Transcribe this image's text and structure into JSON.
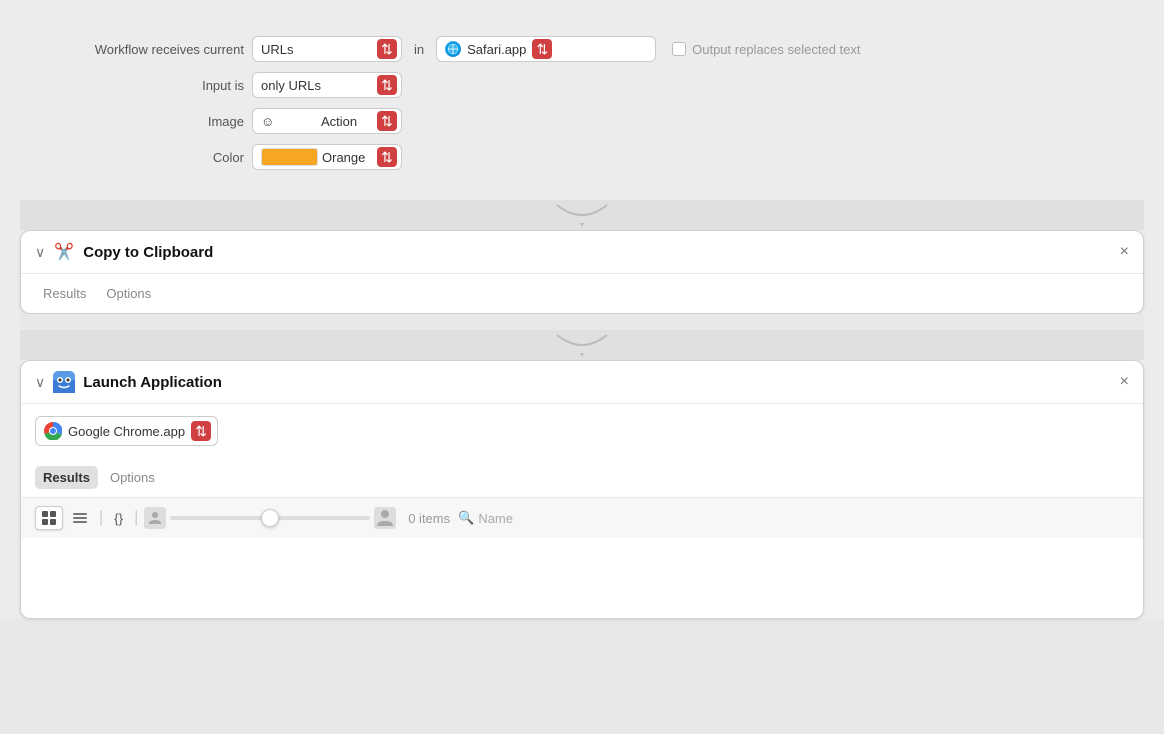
{
  "workflow": {
    "receives_label": "Workflow receives current",
    "input_type": "URLs",
    "in_label": "in",
    "app_name": "Safari.app",
    "input_is_label": "Input is",
    "input_is_value": "only URLs",
    "image_label": "Image",
    "image_value": "Action",
    "image_icon": "☺",
    "color_label": "Color",
    "color_value": "Orange",
    "output_label": "Output replaces selected text"
  },
  "copy_clipboard": {
    "title": "Copy to Clipboard",
    "icon": "✂",
    "tabs": [
      {
        "id": "results",
        "label": "Results",
        "active": false
      },
      {
        "id": "options",
        "label": "Options",
        "active": false
      }
    ],
    "close_label": "×"
  },
  "launch_application": {
    "title": "Launch Application",
    "icon": "🔵",
    "app_name": "Google Chrome.app",
    "close_label": "×",
    "tabs": [
      {
        "id": "results",
        "label": "Results",
        "active": true
      },
      {
        "id": "options",
        "label": "Options",
        "active": false
      }
    ],
    "items_count": "0 items",
    "search_label": "Name"
  },
  "toolbar": {
    "grid_icon": "⊞",
    "list_icon": "≡",
    "json_icon": "{}",
    "person_start": "👤",
    "person_end": "👤"
  }
}
